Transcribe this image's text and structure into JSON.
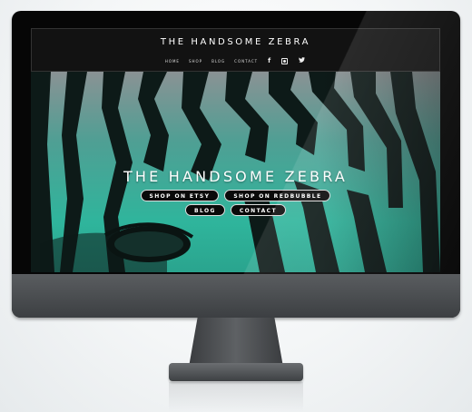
{
  "site": {
    "title": "THE HANDSOME ZEBRA",
    "nav": [
      "HOME",
      "SHOP",
      "BLOG",
      "CONTACT"
    ],
    "social_icons": [
      "facebook-icon",
      "instagram-icon",
      "twitter-icon"
    ]
  },
  "hero": {
    "title": "THE HANDSOME ZEBRA",
    "buttons_row1": [
      "SHOP ON ETSY",
      "SHOP ON REDBUBBLE"
    ],
    "buttons_row2": [
      "BLOG",
      "CONTACT"
    ]
  },
  "colors": {
    "teal_tint": "#2fb59c",
    "header_bg": "#121212",
    "button_bg": "#0a0a0a"
  }
}
